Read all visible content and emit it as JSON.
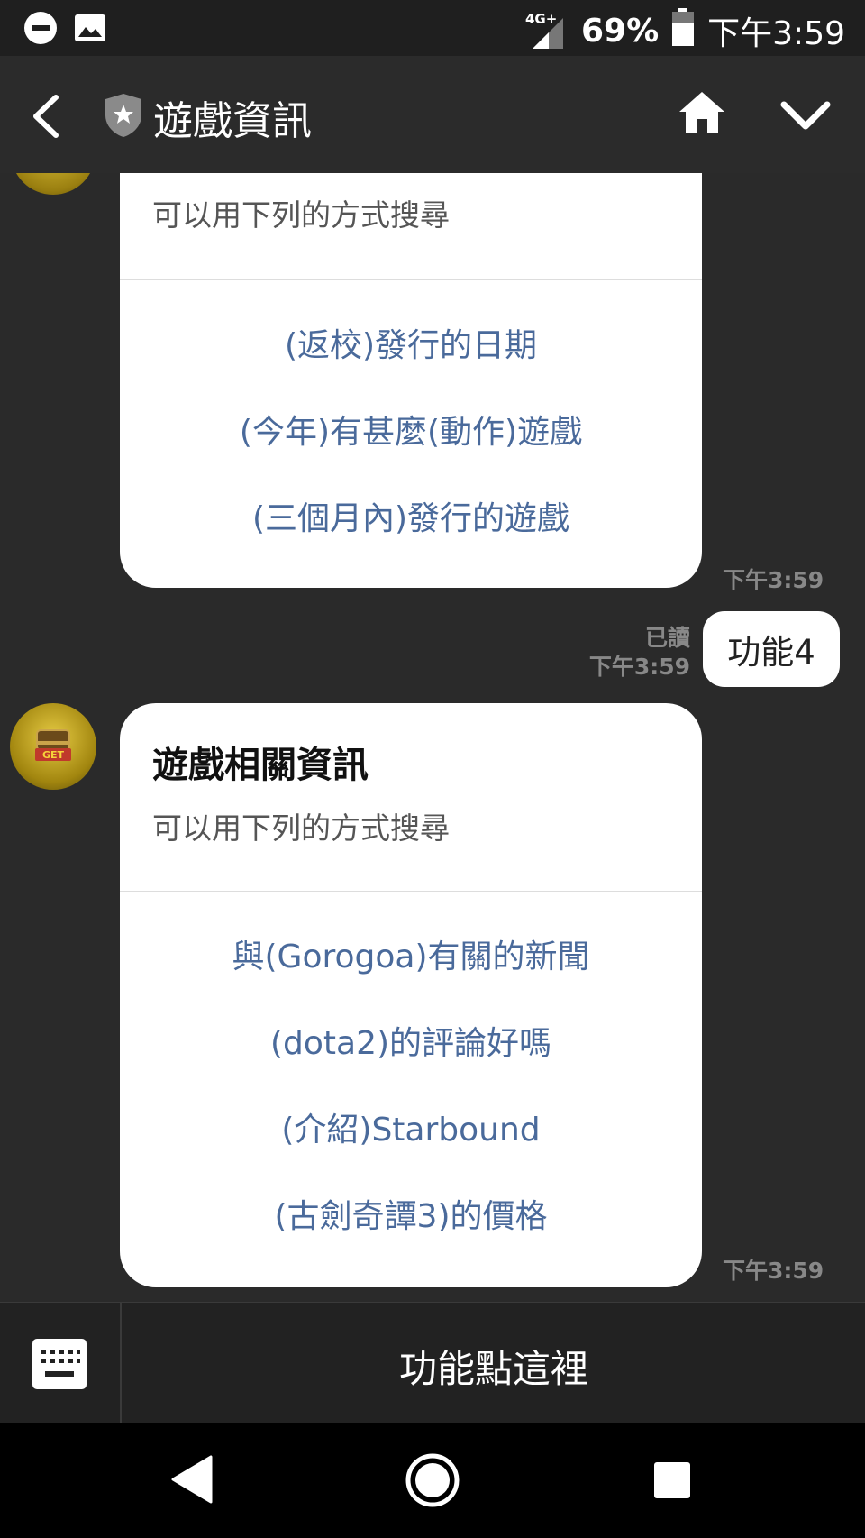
{
  "status_bar": {
    "network": "4G+",
    "battery": "69%",
    "time": "下午3:59"
  },
  "header": {
    "title": "遊戲資訊"
  },
  "chat": {
    "card1": {
      "subtitle": "可以用下列的方式搜尋",
      "links": [
        "(返校)發行的日期",
        "(今年)有甚麼(動作)遊戲",
        "(三個月內)發行的遊戲"
      ],
      "time": "下午3:59"
    },
    "user_message": {
      "text": "功能4",
      "read": "已讀",
      "time": "下午3:59"
    },
    "card2": {
      "title": "遊戲相關資訊",
      "subtitle": "可以用下列的方式搜尋",
      "links": [
        "與(Gorogoa)有關的新聞",
        "(dota2)的評論好嗎",
        "(介紹)Starbound",
        "(古劍奇譚3)的價格"
      ],
      "time": "下午3:59",
      "avatar_text": "GET"
    }
  },
  "footer": {
    "menu_label": "功能點這裡"
  }
}
